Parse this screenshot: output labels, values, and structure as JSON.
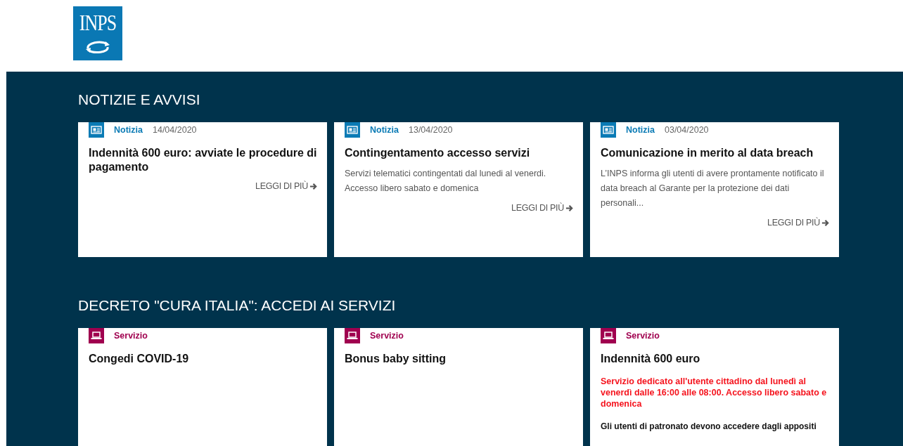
{
  "logo": {
    "text": "INPS"
  },
  "sections": [
    {
      "title": "NOTIZIE E AVVISI",
      "cards": [
        {
          "kind": "news",
          "category": "Notizia",
          "date": "14/04/2020",
          "title": "Indennità 600 euro: avviate le procedure di pagamento",
          "link": "LEGGI DI PIÙ"
        },
        {
          "kind": "news",
          "category": "Notizia",
          "date": "13/04/2020",
          "title": "Contingentamento accesso servizi",
          "description": "Servizi telematici contingentati dal lunedi al venerdi. Accesso libero sabato e domenica",
          "link": "LEGGI DI PIÙ"
        },
        {
          "kind": "news",
          "category": "Notizia",
          "date": "03/04/2020",
          "title": "Comunicazione in merito al data breach",
          "description": "L’INPS informa gli utenti di avere prontamente notificato il data breach al Garante per la protezione dei dati personali...",
          "link": "LEGGI DI PIÙ"
        }
      ]
    },
    {
      "title": "DECRETO \"CURA ITALIA\": ACCEDI AI SERVIZI",
      "cards": [
        {
          "kind": "service",
          "category": "Servizio",
          "title": "Congedi COVID-19"
        },
        {
          "kind": "service",
          "category": "Servizio",
          "title": "Bonus baby sitting"
        },
        {
          "kind": "service",
          "category": "Servizio",
          "title": "Indennità 600 euro",
          "notice": "Servizio dedicato all'utente cittadino dal lunedì al venerdì dalle 16:00 alle 08:00. Accesso libero sabato e domenica",
          "note": "Gli utenti di patronato devono accedere dagli appositi"
        }
      ]
    }
  ]
}
